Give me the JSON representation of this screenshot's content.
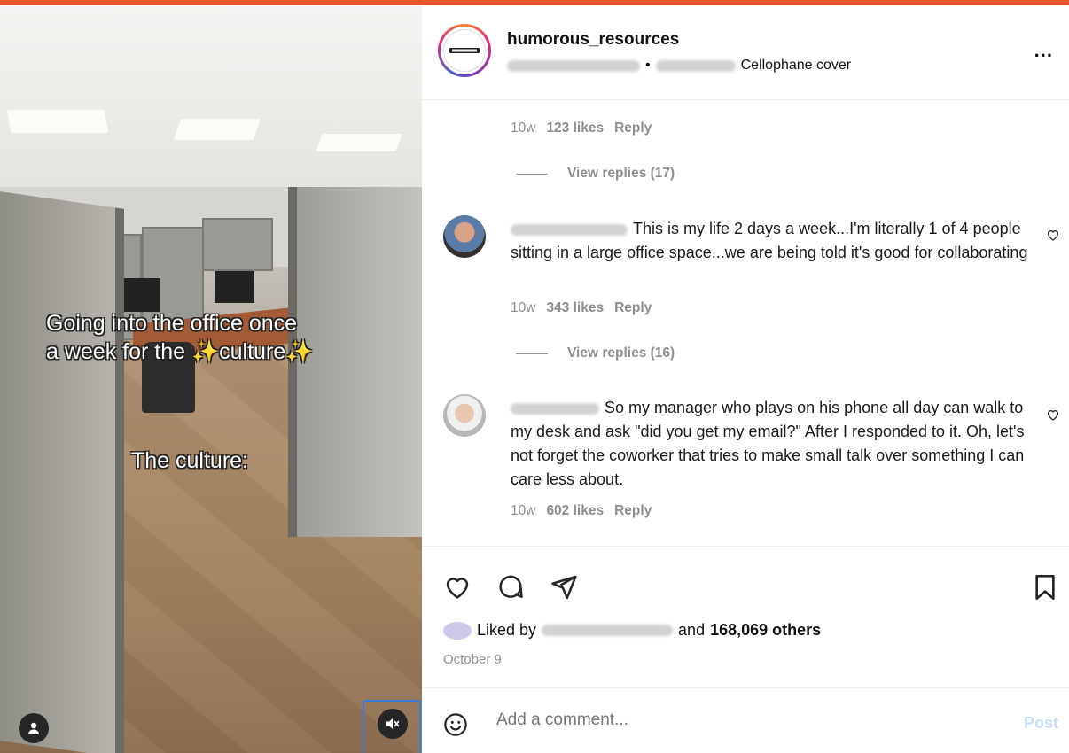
{
  "colors": {
    "accent_bar": "#e8582b",
    "muted_text": "#8e8e8e",
    "post_button_disabled": "#c7dffa",
    "sparkle": "#f5d33b"
  },
  "media": {
    "caption_line1": "Going into the office once",
    "caption_line2_prefix": "a week for the ",
    "caption_line2_word": "culture",
    "sparkle_glyph": "✨",
    "caption_bottom": "The culture:",
    "user_tag_icon": "person-icon",
    "mute_icon": "speaker-muted-icon"
  },
  "header": {
    "username": "humorous_resources",
    "separator": "•",
    "audio_title": "Cellophane cover",
    "more_icon": "more-horizontal-icon",
    "more_label": "..."
  },
  "comments": {
    "first_meta": {
      "age": "10w",
      "likes": "123 likes",
      "reply": "Reply"
    },
    "first_view_replies": "View replies (17)",
    "items": [
      {
        "text": "This is my life 2 days a week...I'm literally 1 of 4 people sitting in a large office space...we are being told it's good for collaborating",
        "age": "10w",
        "likes": "343 likes",
        "reply": "Reply",
        "view_replies": "View replies (16)"
      },
      {
        "text": "So my manager who plays on his phone all day can walk to my desk and ask \"did you get my email?\" After I responded to it. Oh, let's not forget the coworker that tries to make small talk over something I can care less about.",
        "age": "10w",
        "likes": "602 likes",
        "reply": "Reply"
      }
    ]
  },
  "actions": {
    "like_icon": "heart-icon",
    "comment_icon": "comment-icon",
    "share_icon": "send-icon",
    "save_icon": "bookmark-icon",
    "liked_by_prefix": "Liked by",
    "liked_by_and": "and",
    "liked_by_count": "168,069 others",
    "date": "October 9"
  },
  "comment_bar": {
    "emoji_icon": "emoji-icon",
    "placeholder": "Add a comment...",
    "post_label": "Post"
  }
}
